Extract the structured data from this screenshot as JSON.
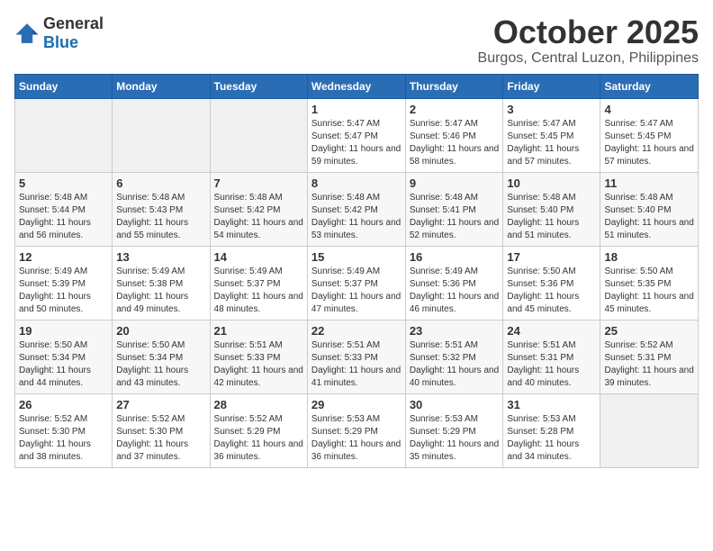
{
  "header": {
    "logo_general": "General",
    "logo_blue": "Blue",
    "month": "October 2025",
    "location": "Burgos, Central Luzon, Philippines"
  },
  "weekdays": [
    "Sunday",
    "Monday",
    "Tuesday",
    "Wednesday",
    "Thursday",
    "Friday",
    "Saturday"
  ],
  "weeks": [
    [
      {
        "day": "",
        "empty": true
      },
      {
        "day": "",
        "empty": true
      },
      {
        "day": "",
        "empty": true
      },
      {
        "day": "1",
        "sunrise": "5:47 AM",
        "sunset": "5:47 PM",
        "daylight": "11 hours and 59 minutes."
      },
      {
        "day": "2",
        "sunrise": "5:47 AM",
        "sunset": "5:46 PM",
        "daylight": "11 hours and 58 minutes."
      },
      {
        "day": "3",
        "sunrise": "5:47 AM",
        "sunset": "5:45 PM",
        "daylight": "11 hours and 57 minutes."
      },
      {
        "day": "4",
        "sunrise": "5:47 AM",
        "sunset": "5:45 PM",
        "daylight": "11 hours and 57 minutes."
      }
    ],
    [
      {
        "day": "5",
        "sunrise": "5:48 AM",
        "sunset": "5:44 PM",
        "daylight": "11 hours and 56 minutes."
      },
      {
        "day": "6",
        "sunrise": "5:48 AM",
        "sunset": "5:43 PM",
        "daylight": "11 hours and 55 minutes."
      },
      {
        "day": "7",
        "sunrise": "5:48 AM",
        "sunset": "5:42 PM",
        "daylight": "11 hours and 54 minutes."
      },
      {
        "day": "8",
        "sunrise": "5:48 AM",
        "sunset": "5:42 PM",
        "daylight": "11 hours and 53 minutes."
      },
      {
        "day": "9",
        "sunrise": "5:48 AM",
        "sunset": "5:41 PM",
        "daylight": "11 hours and 52 minutes."
      },
      {
        "day": "10",
        "sunrise": "5:48 AM",
        "sunset": "5:40 PM",
        "daylight": "11 hours and 51 minutes."
      },
      {
        "day": "11",
        "sunrise": "5:48 AM",
        "sunset": "5:40 PM",
        "daylight": "11 hours and 51 minutes."
      }
    ],
    [
      {
        "day": "12",
        "sunrise": "5:49 AM",
        "sunset": "5:39 PM",
        "daylight": "11 hours and 50 minutes."
      },
      {
        "day": "13",
        "sunrise": "5:49 AM",
        "sunset": "5:38 PM",
        "daylight": "11 hours and 49 minutes."
      },
      {
        "day": "14",
        "sunrise": "5:49 AM",
        "sunset": "5:37 PM",
        "daylight": "11 hours and 48 minutes."
      },
      {
        "day": "15",
        "sunrise": "5:49 AM",
        "sunset": "5:37 PM",
        "daylight": "11 hours and 47 minutes."
      },
      {
        "day": "16",
        "sunrise": "5:49 AM",
        "sunset": "5:36 PM",
        "daylight": "11 hours and 46 minutes."
      },
      {
        "day": "17",
        "sunrise": "5:50 AM",
        "sunset": "5:36 PM",
        "daylight": "11 hours and 45 minutes."
      },
      {
        "day": "18",
        "sunrise": "5:50 AM",
        "sunset": "5:35 PM",
        "daylight": "11 hours and 45 minutes."
      }
    ],
    [
      {
        "day": "19",
        "sunrise": "5:50 AM",
        "sunset": "5:34 PM",
        "daylight": "11 hours and 44 minutes."
      },
      {
        "day": "20",
        "sunrise": "5:50 AM",
        "sunset": "5:34 PM",
        "daylight": "11 hours and 43 minutes."
      },
      {
        "day": "21",
        "sunrise": "5:51 AM",
        "sunset": "5:33 PM",
        "daylight": "11 hours and 42 minutes."
      },
      {
        "day": "22",
        "sunrise": "5:51 AM",
        "sunset": "5:33 PM",
        "daylight": "11 hours and 41 minutes."
      },
      {
        "day": "23",
        "sunrise": "5:51 AM",
        "sunset": "5:32 PM",
        "daylight": "11 hours and 40 minutes."
      },
      {
        "day": "24",
        "sunrise": "5:51 AM",
        "sunset": "5:31 PM",
        "daylight": "11 hours and 40 minutes."
      },
      {
        "day": "25",
        "sunrise": "5:52 AM",
        "sunset": "5:31 PM",
        "daylight": "11 hours and 39 minutes."
      }
    ],
    [
      {
        "day": "26",
        "sunrise": "5:52 AM",
        "sunset": "5:30 PM",
        "daylight": "11 hours and 38 minutes."
      },
      {
        "day": "27",
        "sunrise": "5:52 AM",
        "sunset": "5:30 PM",
        "daylight": "11 hours and 37 minutes."
      },
      {
        "day": "28",
        "sunrise": "5:52 AM",
        "sunset": "5:29 PM",
        "daylight": "11 hours and 36 minutes."
      },
      {
        "day": "29",
        "sunrise": "5:53 AM",
        "sunset": "5:29 PM",
        "daylight": "11 hours and 36 minutes."
      },
      {
        "day": "30",
        "sunrise": "5:53 AM",
        "sunset": "5:29 PM",
        "daylight": "11 hours and 35 minutes."
      },
      {
        "day": "31",
        "sunrise": "5:53 AM",
        "sunset": "5:28 PM",
        "daylight": "11 hours and 34 minutes."
      },
      {
        "day": "",
        "empty": true
      }
    ]
  ],
  "labels": {
    "sunrise": "Sunrise:",
    "sunset": "Sunset:",
    "daylight": "Daylight:"
  }
}
